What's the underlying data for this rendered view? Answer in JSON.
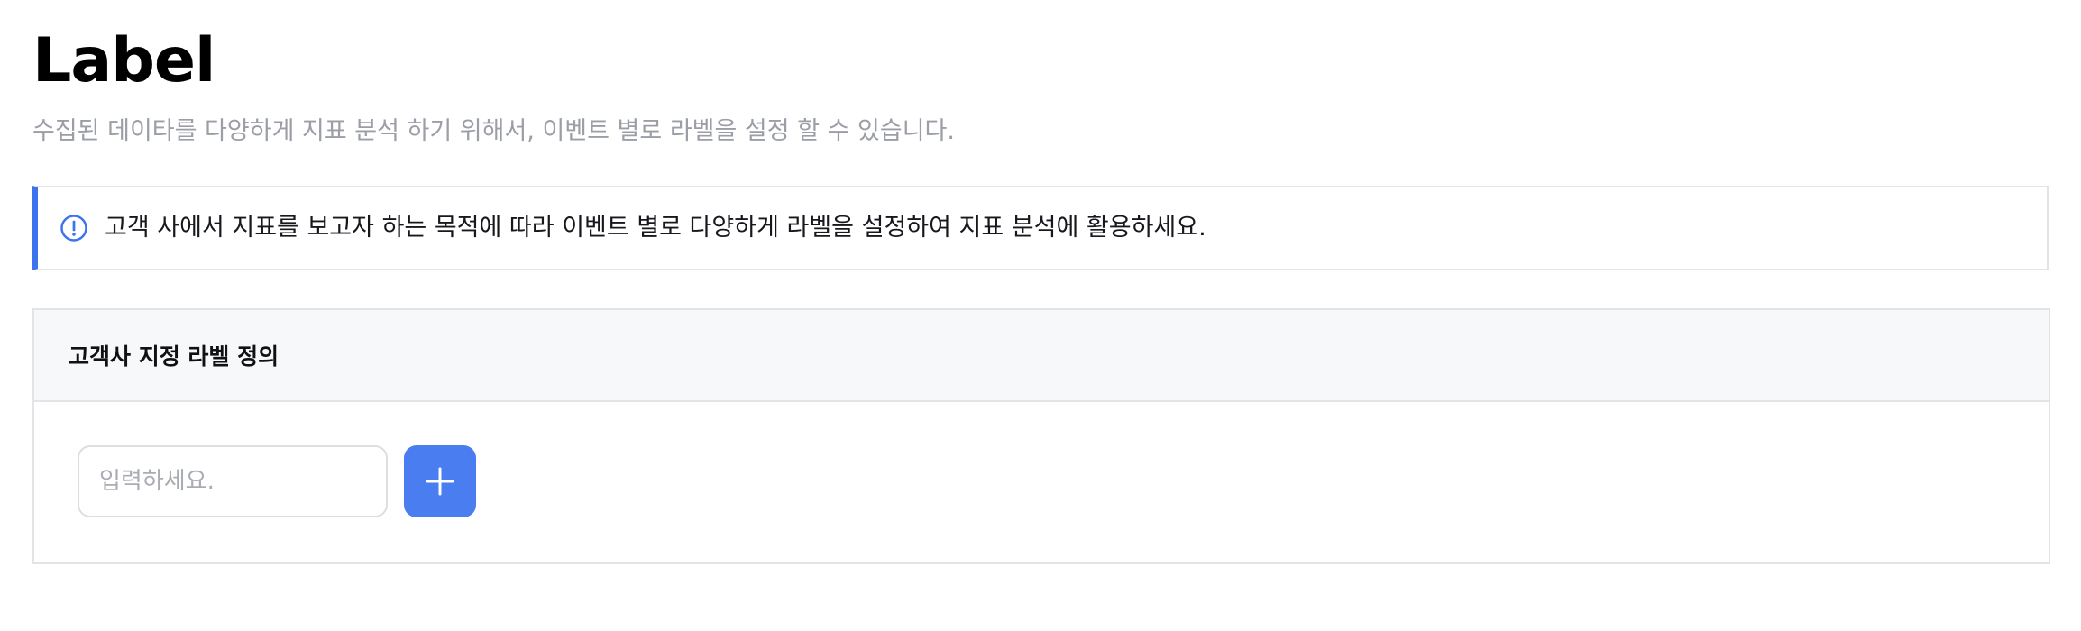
{
  "header": {
    "title": "Label",
    "subtitle": "수집된 데이타를 다양하게 지표 분석 하기 위해서, 이벤트 별로 라벨을 설정 할 수 있습니다."
  },
  "notice": {
    "icon": "info-circle-icon",
    "text": "고객 사에서 지표를 보고자 하는 목적에 따라 이벤트 별로 다양하게 라벨을 설정하여 지표 분석에 활용하세요.",
    "accent_color": "#3d73ee"
  },
  "label_panel": {
    "title": "고객사 지정 라벨 정의",
    "input": {
      "value": "",
      "placeholder": "입력하세요."
    },
    "add_button": {
      "icon": "plus-icon",
      "color": "#4a7ef0"
    }
  }
}
